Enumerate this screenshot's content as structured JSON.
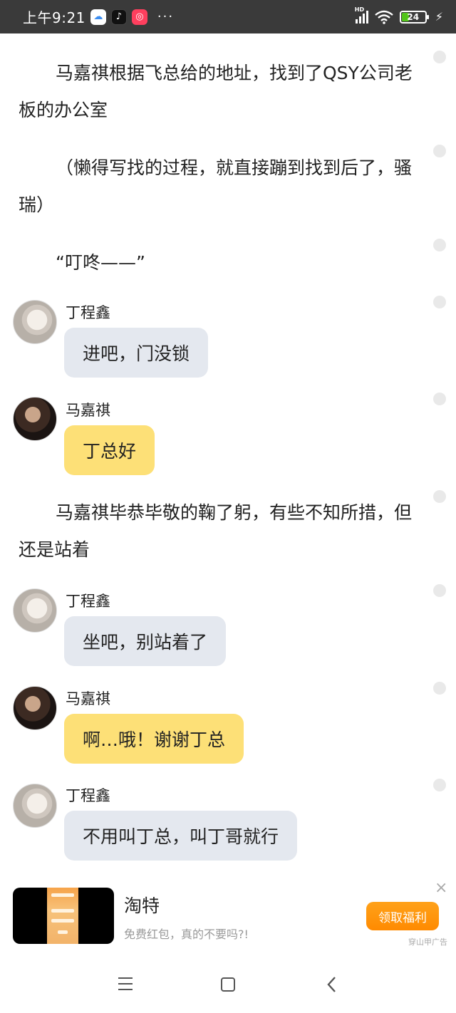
{
  "status_bar": {
    "time": "上午9:21",
    "app_icons": [
      "cloud-icon",
      "tiktok-icon",
      "kuaishou-icon"
    ],
    "more": "···",
    "network": "HD",
    "battery": "24"
  },
  "story": {
    "paragraphs": [
      "马嘉祺根据飞总给的地址，找到了QSY公司老板的办公室",
      "（懒得写找的过程，就直接蹦到找到后了，骚瑞）",
      "“叮咚——”",
      "马嘉祺毕恭毕敬的鞠了躬，有些不知所措，但还是站着"
    ],
    "messages": [
      {
        "speaker": "丁程鑫",
        "text": "进吧，门没锁"
      },
      {
        "speaker": "马嘉祺",
        "text": "丁总好"
      },
      {
        "speaker": "丁程鑫",
        "text": "坐吧，别站着了"
      },
      {
        "speaker": "马嘉祺",
        "text": "啊…哦！谢谢丁总"
      },
      {
        "speaker": "丁程鑫",
        "text": "不用叫丁总，叫丁哥就行"
      }
    ]
  },
  "ad": {
    "title": "淘特",
    "description": "免费红包，真的不要吗?!",
    "button": "领取福利",
    "source": "穿山甲广告",
    "close": "×"
  },
  "colors": {
    "status_bar_bg": "#3a3a3a",
    "bubble_grey": "#e4e8ef",
    "bubble_yellow": "#fde077",
    "ad_button": "#ff8a00"
  }
}
